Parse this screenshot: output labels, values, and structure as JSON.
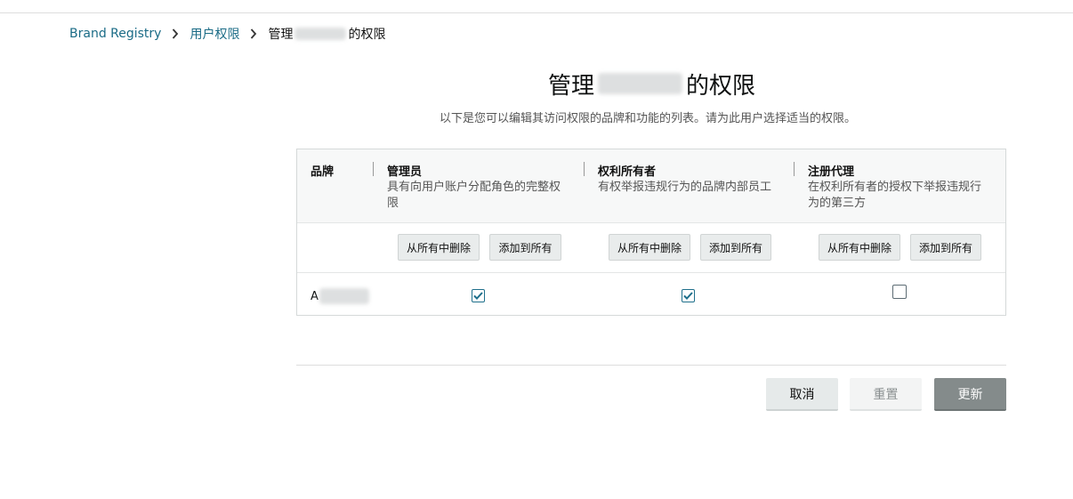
{
  "breadcrumb": {
    "items": [
      "Brand Registry",
      "用户权限"
    ],
    "current_prefix": "管理",
    "current_suffix": "的权限"
  },
  "page": {
    "title_prefix": "管理",
    "title_suffix": "的权限",
    "subtitle": "以下是您可以编辑其访问权限的品牌和功能的列表。请为此用户选择适当的权限。"
  },
  "table": {
    "brand_header": "品牌",
    "columns": [
      {
        "name": "管理员",
        "desc_line1": "具有向用户账户分配角色的完整权",
        "desc_line2": "限"
      },
      {
        "name": "权利所有者",
        "desc_line1": "有权举报违规行为的品牌内部员工",
        "desc_line2": ""
      },
      {
        "name": "注册代理",
        "desc_line1": "在权利所有者的授权下举报违规行",
        "desc_line2": "为的第三方"
      }
    ],
    "remove_all_label": "从所有中删除",
    "add_all_label": "添加到所有",
    "rows": [
      {
        "brand_visible": "A",
        "checked": [
          true,
          true,
          false
        ]
      }
    ]
  },
  "footer": {
    "cancel_label": "取消",
    "reset_label": "重置",
    "update_label": "更新"
  },
  "colors": {
    "link": "#1a6b86",
    "checkbox": "#1f6f8b",
    "update_button": "#848b8b"
  }
}
